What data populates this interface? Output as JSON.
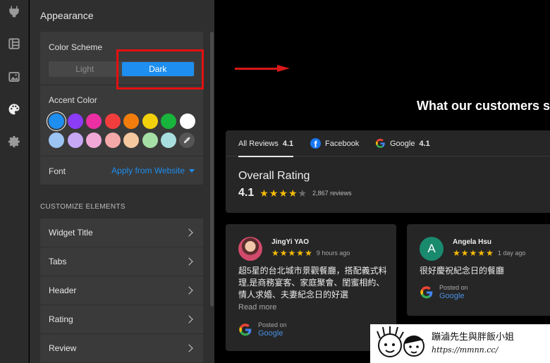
{
  "panel": {
    "title": "Appearance",
    "color_scheme": {
      "label": "Color Scheme",
      "options": [
        "Light",
        "Dark"
      ],
      "selected": "Dark"
    },
    "accent_color": {
      "label": "Accent Color",
      "swatches_row1": [
        "#1e8ef0",
        "#8b3cf7",
        "#ec2fa3",
        "#f23d3d",
        "#f27d0c",
        "#f2d10c",
        "#19b43b",
        "#ffffff"
      ],
      "swatches_row2": [
        "#9cc4f2",
        "#c7a8f5",
        "#f2a8d6",
        "#f5a8a8",
        "#f5c8a0",
        "#a6dfa6",
        "#a8dede"
      ],
      "selected": "#1e8ef0"
    },
    "font": {
      "label": "Font",
      "value": "Apply from Website"
    },
    "customize_label": "CUSTOMIZE ELEMENTS",
    "elements": [
      "Widget Title",
      "Tabs",
      "Header",
      "Rating",
      "Review"
    ]
  },
  "preview": {
    "title": "What our customers s",
    "tabs": [
      {
        "label": "All Reviews",
        "rating": "4.1"
      },
      {
        "label": "Facebook",
        "rating": ""
      },
      {
        "label": "Google",
        "rating": "4.1"
      }
    ],
    "overall": {
      "title": "Overall Rating",
      "rating": "4.1",
      "stars": 4,
      "count": "2,867",
      "count_suffix": "reviews"
    },
    "reviews": [
      {
        "name": "JingYi YAO",
        "stars": 5,
        "time": "9 hours ago",
        "text": "超5星的台北城市景觀餐廳，搭配義式料理,是商務宴客、家庭聚會、閨蜜相約、情人求婚、夫妻紀念日的好選",
        "read_more": "Read more",
        "posted_label": "Posted on",
        "source": "Google"
      },
      {
        "name": "Angela Hsu",
        "avatar_letter": "A",
        "stars": 5,
        "time": "1 day ago",
        "text": "很好慶祝紀念日的餐廳",
        "posted_label": "Posted on",
        "source": "Google"
      }
    ]
  },
  "watermark": {
    "name": "蹦滷先生與胖飯小姐",
    "url": "https://mmnn.cc/"
  },
  "colors": {
    "accent": "#1e8ef0",
    "highlight": "#e31010",
    "star": "#f6bb06"
  }
}
